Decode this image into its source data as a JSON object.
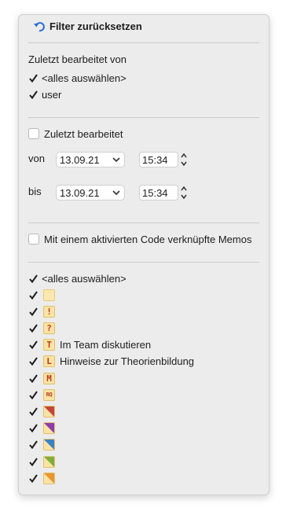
{
  "reset": {
    "label": "Filter zurücksetzen"
  },
  "edited_by": {
    "heading": "Zuletzt bearbeitet von",
    "items": [
      {
        "label": "<alles auswählen>",
        "checked": true
      },
      {
        "label": "user",
        "checked": true
      }
    ]
  },
  "last_edited": {
    "label": "Zuletzt bearbeitet",
    "checked": false,
    "from": {
      "label": "von",
      "date": "13.09.21",
      "time": "15:34"
    },
    "to": {
      "label": "bis",
      "date": "13.09.21",
      "time": "15:34"
    }
  },
  "active_code": {
    "label": "Mit einem aktivierten Code verknüpfte Memos",
    "checked": false
  },
  "memo_types": {
    "select_all": "<alles auswählen>",
    "items": [
      {
        "icon": "blank-memo-icon",
        "letter": "",
        "label": ""
      },
      {
        "icon": "exclamation-memo-icon",
        "letter": "!",
        "label": ""
      },
      {
        "icon": "question-memo-icon",
        "letter": "?",
        "label": ""
      },
      {
        "icon": "t-memo-icon",
        "letter": "T",
        "label": "Im Team diskutieren"
      },
      {
        "icon": "l-memo-icon",
        "letter": "L",
        "label": "Hinweise zur Theorienbildung"
      },
      {
        "icon": "m-memo-icon",
        "letter": "M",
        "label": ""
      },
      {
        "icon": "rq-memo-icon",
        "letter": "RQ",
        "label": ""
      },
      {
        "icon": "red-corner-memo-icon",
        "color": "#c5453a",
        "label": ""
      },
      {
        "icon": "purple-corner-memo-icon",
        "color": "#8e3ea8",
        "label": ""
      },
      {
        "icon": "blue-corner-memo-icon",
        "color": "#3b82c4",
        "label": ""
      },
      {
        "icon": "green-corner-memo-icon",
        "color": "#7fae3b",
        "label": ""
      },
      {
        "icon": "orange-corner-memo-icon",
        "color": "#e9962e",
        "label": ""
      }
    ]
  }
}
